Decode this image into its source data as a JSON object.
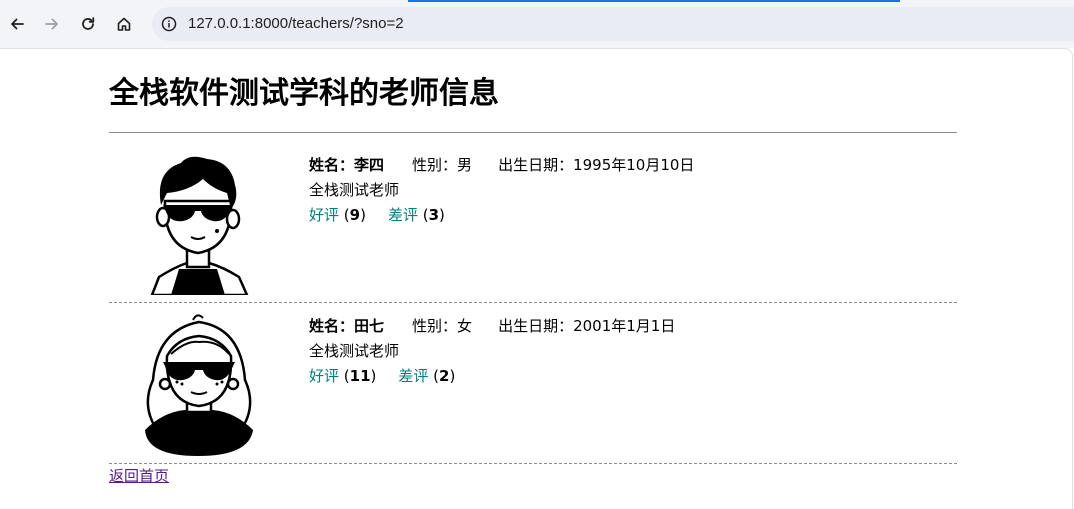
{
  "browser": {
    "url": "127.0.0.1:8000/teachers/?sno=2",
    "back_icon": "arrow-left-icon",
    "forward_icon": "arrow-right-icon",
    "reload_icon": "reload-icon",
    "home_icon": "home-icon",
    "info_icon": "info-icon"
  },
  "page": {
    "title": "全栈软件测试学科的老师信息",
    "back_link": "返回首页"
  },
  "labels": {
    "name": "姓名：",
    "gender": "性别：",
    "birthday": "出生日期：",
    "good": "好评",
    "bad": "差评"
  },
  "teachers": [
    {
      "name": "李四",
      "gender": "男",
      "birthday": "1995年10月10日",
      "intro": "全栈测试老师",
      "good_count": "9",
      "bad_count": "3",
      "avatar": "male-sunglasses-avatar"
    },
    {
      "name": "田七",
      "gender": "女",
      "birthday": "2001年1月1日",
      "intro": "全栈测试老师",
      "good_count": "11",
      "bad_count": "2",
      "avatar": "female-sunglasses-avatar"
    }
  ]
}
